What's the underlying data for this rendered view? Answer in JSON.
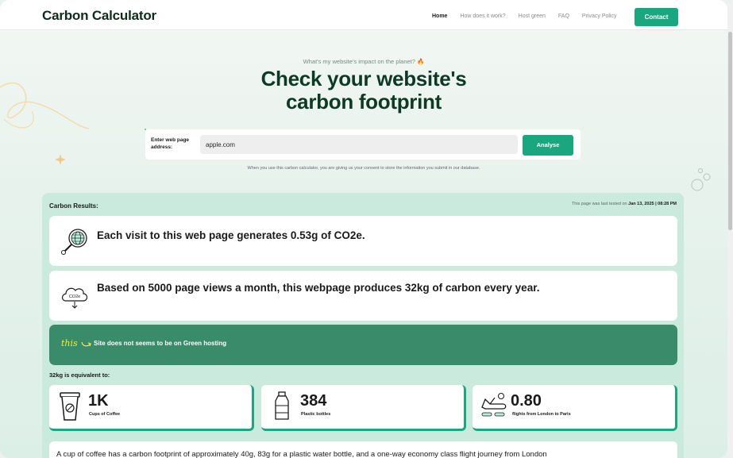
{
  "header": {
    "logo": "Carbon Calculator",
    "nav": [
      "Home",
      "How does it work?",
      "Host green",
      "FAQ",
      "Privacy Policy"
    ],
    "contact_label": "Contact"
  },
  "hero": {
    "kicker": "What's my website's impact on the planet? 🔥",
    "title_line1": "Check your website's",
    "title_line2": "carbon footprint"
  },
  "search": {
    "label": "Enter web page address:",
    "value": "apple.com",
    "button": "Analyse",
    "consent": "When you use this carbon calculator, you are giving us your consent to store the information you submit in our database."
  },
  "results": {
    "title": "Carbon Results:",
    "tested_prefix": "This page was last tested on ",
    "tested_date": "Jan 13, 2025 | 08:28 PM",
    "visit_text": "Each visit to this web page generates 0.53g of CO2e.",
    "yearly_text": "Based on 5000 page views a month, this webpage produces 32kg of carbon every year.",
    "banner_this": "this",
    "banner_text": "Site does not seems to be on Green hosting",
    "equiv_label": "32kg is equivalent to:",
    "equivalents": [
      {
        "value": "1K",
        "label": "Cups of Coffee",
        "icon": "coffee-cup-icon"
      },
      {
        "value": "384",
        "label": "Plastic bottles",
        "icon": "bottle-icon"
      },
      {
        "value": "0.80",
        "label": "flights from London to Paris",
        "icon": "plane-icon"
      }
    ],
    "bottom_text": "A cup of coffee has a carbon footprint of approximately 40g, 83g for a plastic water bottle, and a one-way economy class flight journey from London"
  },
  "colors": {
    "brand_green": "#1aa67f",
    "dark_green": "#0d3a27",
    "banner_green": "#3a8b69",
    "results_bg": "#c9eadc"
  }
}
